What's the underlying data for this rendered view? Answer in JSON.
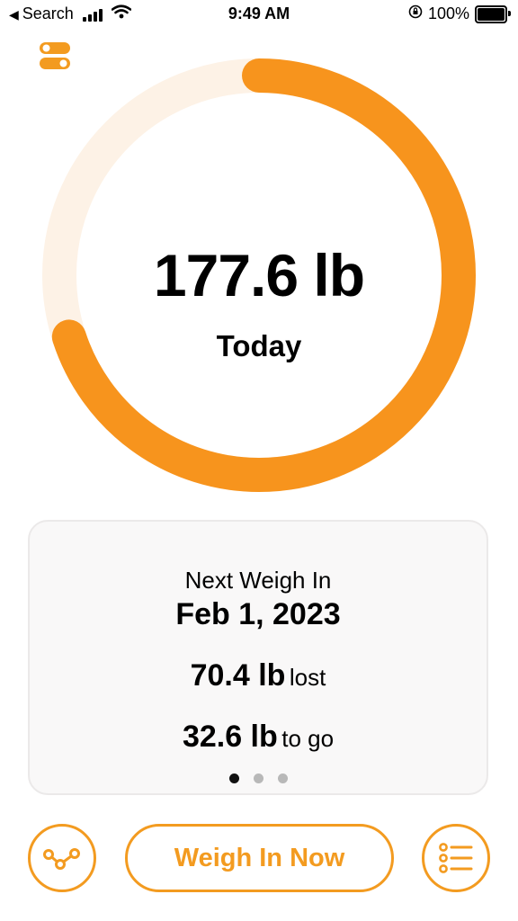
{
  "status_bar": {
    "back_label": "Search",
    "time": "9:49 AM",
    "battery": "100%",
    "icons": [
      "back-arrow-icon",
      "signal-bars-icon",
      "wifi-icon",
      "orientation-lock-icon",
      "battery-icon"
    ]
  },
  "header": {
    "toggle_icon": "toggle-settings-icon"
  },
  "progress_ring": {
    "progress_fraction": 0.7,
    "weight": "177.6 lb",
    "label": "Today",
    "colors": {
      "progress": "#f7941d",
      "track": "#fdf2e6"
    }
  },
  "card": {
    "next_label": "Next Weigh In",
    "next_date": "Feb 1, 2023",
    "lost_value": "70.4 lb",
    "lost_unit": "lost",
    "togo_value": "32.6 lb",
    "togo_unit": "to go",
    "page_count": 3,
    "active_page": 1
  },
  "actions": {
    "trend_icon": "trend-graph-icon",
    "weigh_in_label": "Weigh In Now",
    "list_icon": "list-icon",
    "accent": "#f39b20"
  }
}
